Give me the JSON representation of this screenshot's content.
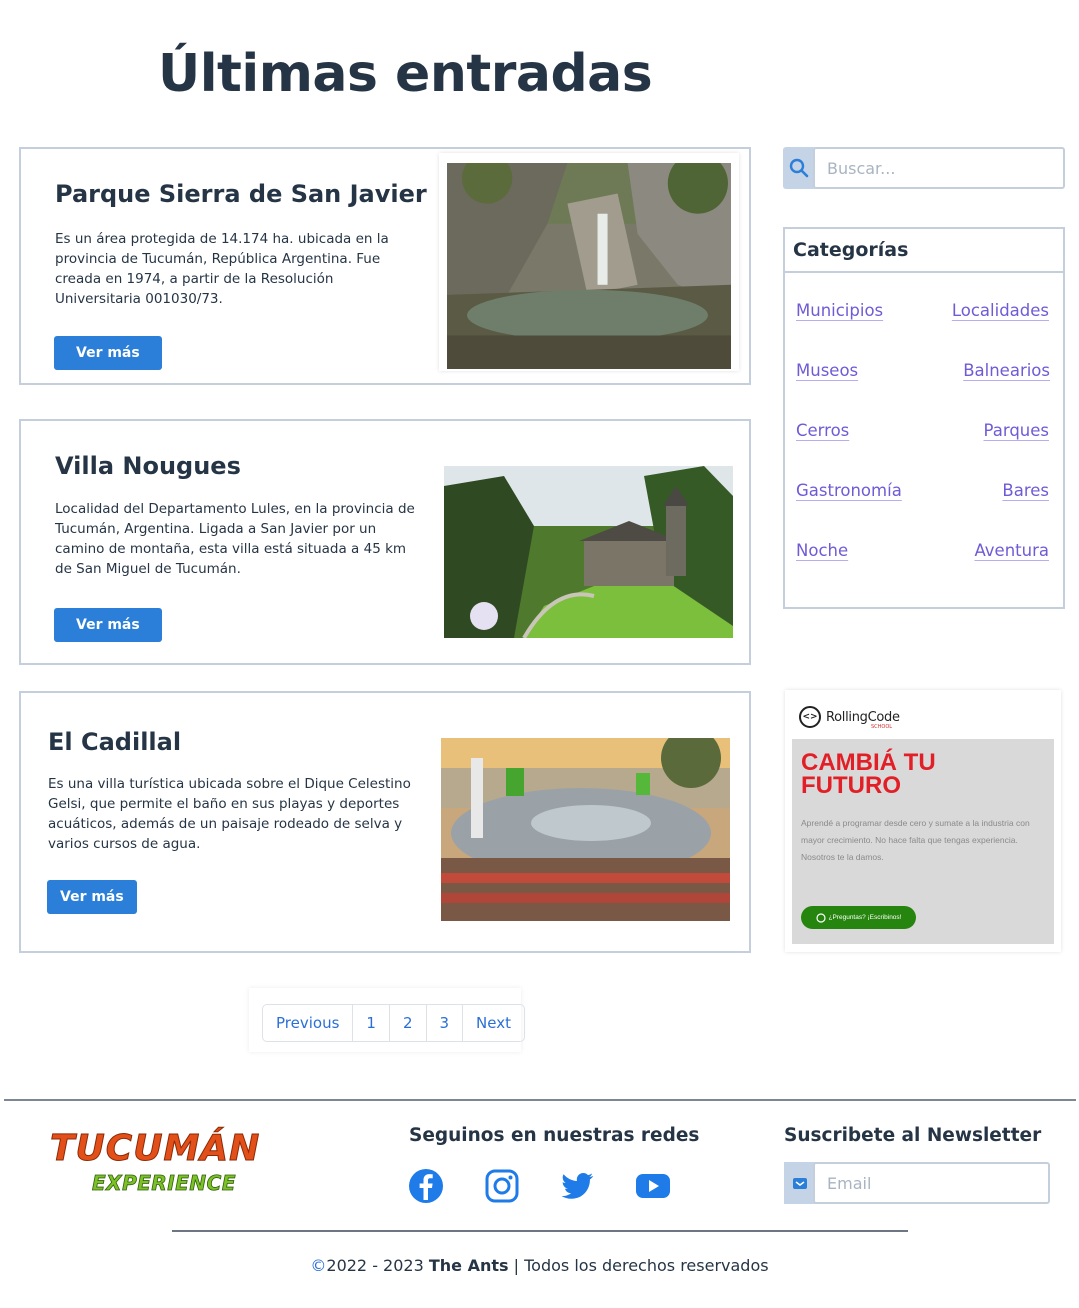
{
  "page_title": "Últimas entradas",
  "posts": [
    {
      "title": "Parque Sierra de San Javier",
      "description": "Es un área protegida de 14.174 ha. ubicada en la provincia de Tucumán, República Argentina. Fue creada en 1974, a partir de la Resolución Universitaria 001030/73.",
      "button": "Ver más"
    },
    {
      "title": "Villa Nougues",
      "description": "Localidad del Departamento Lules, en la provincia de Tucumán, Argentina. Ligada a San Javier por un camino de montaña, esta villa está situada a 45 km de San Miguel de Tucumán.",
      "button": "Ver más"
    },
    {
      "title": "El Cadillal",
      "description": "Es una villa turística ubicada sobre el Dique Celestino Gelsi, que permite el baño en sus playas y deportes acuáticos, además de un paisaje rodeado de selva y varios cursos de agua.",
      "button": "Ver más"
    }
  ],
  "search": {
    "placeholder": "Buscar...",
    "icon": "search-icon"
  },
  "categories": {
    "title": "Categorías",
    "items": [
      "Municipios",
      "Localidades",
      "Museos",
      "Balnearios",
      "Cerros",
      "Parques",
      "Gastronomía",
      "Bares",
      "Noche",
      "Aventura"
    ]
  },
  "ad": {
    "logo_text": "RollingCode",
    "logo_symbol": "<>",
    "logo_sub": "SCHOOL",
    "headline": "CAMBIÁ TU FUTURO",
    "body": "Aprendé a programar desde cero y sumate a la industria con mayor crecimiento. No hace falta que tengas experiencia.",
    "body2": "Nosotros te la damos.",
    "button": "¿Preguntas? ¡Escribinos!"
  },
  "pagination": {
    "previous": "Previous",
    "pages": [
      "1",
      "2",
      "3"
    ],
    "next": "Next"
  },
  "footer": {
    "logo_main": "TUCUMÁN",
    "logo_sub": "EXPERIENCE",
    "social_heading": "Seguinos en nuestras redes",
    "social_icons": [
      "facebook-icon",
      "instagram-icon",
      "twitter-icon",
      "youtube-icon"
    ],
    "newsletter_heading": "Suscribete al Newsletter",
    "newsletter_placeholder": "Email",
    "copyright_symbol": "©",
    "copyright_years": "2022 - 2023",
    "copyright_owner": "The Ants",
    "copyright_rest": "| Todos los derechos reservados"
  },
  "colors": {
    "primary": "#2b7fd8",
    "title": "#263545",
    "link": "#6f5bd6",
    "border": "#c5cfdc"
  }
}
